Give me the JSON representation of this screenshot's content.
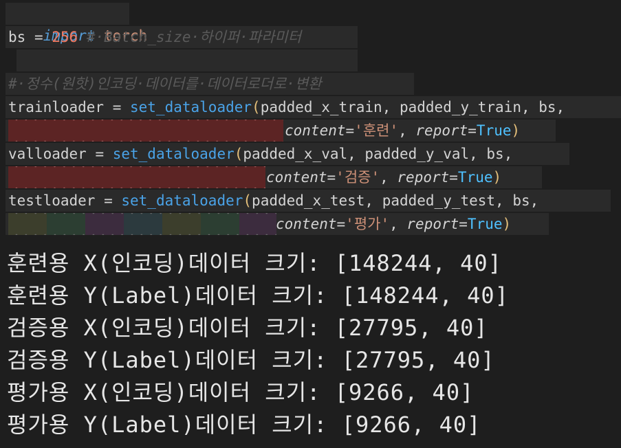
{
  "code": {
    "line1": {
      "kw": "import",
      "mod": "torch"
    },
    "line2": {
      "var": "bs",
      "op": " = ",
      "num": "256",
      "comment": " #·Batch_size·하이퍼·파라미터"
    },
    "line4": {
      "comment": "#·정수(원핫)인코딩·데이터를·데이터로더로·변환"
    },
    "line5": {
      "var": "trainloader",
      "op": " = ",
      "fn": "set_dataloader",
      "open": "(",
      "args": "padded_x_train, padded_y_train, bs,"
    },
    "line6": {
      "param1": "content",
      "eq": "=",
      "str": "'훈련'",
      "comma": ", ",
      "param2": "report",
      "eq2": "=",
      "bool": "True",
      "close": ")"
    },
    "line7": {
      "var": "valloader",
      "op": " = ",
      "fn": "set_dataloader",
      "open": "(",
      "args": "padded_x_val, padded_y_val, bs,"
    },
    "line8": {
      "param1": "content",
      "eq": "=",
      "str": "'검증'",
      "comma": ", ",
      "param2": "report",
      "eq2": "=",
      "bool": "True",
      "close": ")"
    },
    "line9": {
      "var": "testloader",
      "op": " = ",
      "fn": "set_dataloader",
      "open": "(",
      "args": "padded_x_test, padded_y_test, bs, "
    },
    "line10": {
      "param1": "content",
      "eq": "=",
      "str": "'평가'",
      "comma": ", ",
      "param2": "report",
      "eq2": "=",
      "bool": "True",
      "close": ")"
    }
  },
  "output": [
    "훈련용 X(인코딩)데이터 크기: [148244, 40]",
    "훈련용 Y(Label)데이터 크기: [148244, 40]",
    "검증용 X(인코딩)데이터 크기: [27795, 40]",
    "검증용 Y(Label)데이터 크기: [27795, 40]",
    "평가용 X(인코딩)데이터 크기: [9266, 40]",
    "평가용 Y(Label)데이터 크기: [9266, 40]"
  ],
  "colors": {
    "background": "#1e1e1e",
    "keyword": "#569cd6",
    "function": "#4aa3e8",
    "string": "#ce9178",
    "number": "#f07860",
    "comment": "#5a5a5a",
    "boolean": "#4fc1ff",
    "bracket": "#e5c07b",
    "indent_error": "#5c2424"
  }
}
